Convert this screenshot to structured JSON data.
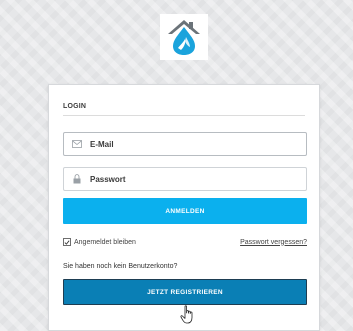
{
  "logo": {
    "icon": "house-water-drop-logo",
    "colors": {
      "roof": "#6b7379",
      "water": "#1aa3dc"
    }
  },
  "login": {
    "heading": "LOGIN",
    "email": {
      "placeholder": "E-Mail",
      "icon": "envelope-icon",
      "value": ""
    },
    "password": {
      "placeholder": "Passwort",
      "icon": "lock-icon",
      "value": ""
    },
    "submit_label": "ANMELDEN",
    "remember_label": "Angemeldet bleiben",
    "remember_checked": true,
    "forgot_label": "Passwort vergessen?",
    "no_account_text": "Sie haben noch kein Benutzerkonto?",
    "register_label": "JETZT REGISTRIEREN"
  },
  "colors": {
    "accent": "#0bb0ee",
    "register": "#0a7fb5",
    "background": "#e6e7e9"
  },
  "cursor": {
    "icon": "hand-pointer-icon"
  }
}
